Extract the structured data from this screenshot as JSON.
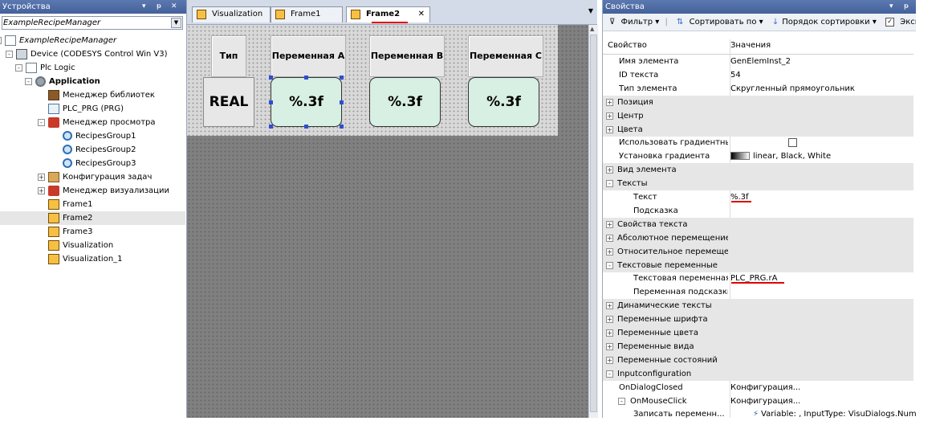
{
  "devices_pane": {
    "title": "Устройства",
    "project_combo": "ExampleRecipeManager",
    "tree": [
      {
        "label": "ExampleRecipeManager",
        "icon": "project-icon",
        "expand": "-"
      },
      {
        "label": "Device (CODESYS Control Win V3)",
        "icon": "device-icon",
        "expand": "-"
      },
      {
        "label": "Plc Logic",
        "icon": "plc-logic-icon",
        "expand": "-"
      },
      {
        "label": "Application",
        "icon": "application-icon",
        "expand": "-"
      },
      {
        "label": "Менеджер библиотек",
        "icon": "library-icon",
        "expand": ""
      },
      {
        "label": "PLC_PRG (PRG)",
        "icon": "program-icon",
        "expand": ""
      },
      {
        "label": "Менеджер просмотра",
        "icon": "watch-manager-icon",
        "expand": "-"
      },
      {
        "label": "RecipesGroup1",
        "icon": "recipe-group-icon",
        "expand": ""
      },
      {
        "label": "RecipesGroup2",
        "icon": "recipe-group-icon",
        "expand": ""
      },
      {
        "label": "RecipesGroup3",
        "icon": "recipe-group-icon",
        "expand": ""
      },
      {
        "label": "Конфигурация задач",
        "icon": "task-config-icon",
        "expand": "+"
      },
      {
        "label": "Менеджер визуализации",
        "icon": "visu-manager-icon",
        "expand": "+"
      },
      {
        "label": "Frame1",
        "icon": "frame-icon",
        "expand": ""
      },
      {
        "label": "Frame2",
        "icon": "frame-icon",
        "expand": ""
      },
      {
        "label": "Frame3",
        "icon": "frame-icon",
        "expand": ""
      },
      {
        "label": "Visualization",
        "icon": "frame-icon",
        "expand": ""
      },
      {
        "label": "Visualization_1",
        "icon": "frame-icon",
        "expand": ""
      }
    ]
  },
  "tabs": [
    {
      "label": "Visualization",
      "active": false
    },
    {
      "label": "Frame1",
      "active": false
    },
    {
      "label": "Frame2",
      "active": true
    }
  ],
  "tab_close": "✕",
  "visu": {
    "headers": [
      "Тип",
      "Переменная A",
      "Переменная B",
      "Переменная C"
    ],
    "values": [
      "REAL",
      "%.3f",
      "%.3f",
      "%.3f"
    ]
  },
  "properties": {
    "title": "Свойства",
    "toolbar": {
      "filter": "Фильтр",
      "sort_by": "Сортировать по",
      "sort_order": "Порядок сортировки",
      "expert": "Эксперт"
    },
    "col_property": "Свойство",
    "col_value": "Значения",
    "rows": [
      {
        "name": "Имя элемента",
        "value": "GenElemInst_2",
        "level": 1,
        "type": "leaf"
      },
      {
        "name": "ID текста",
        "value": "54",
        "level": 1,
        "type": "leaf"
      },
      {
        "name": "Тип элемента",
        "value": "Скругленный прямоугольник",
        "level": 1,
        "type": "leaf"
      },
      {
        "name": "Позиция",
        "value": "",
        "level": 0,
        "type": "cat",
        "expand": "+"
      },
      {
        "name": "Центр",
        "value": "",
        "level": 0,
        "type": "cat",
        "expand": "+"
      },
      {
        "name": "Цвета",
        "value": "",
        "level": 0,
        "type": "cat",
        "expand": "+"
      },
      {
        "name": "Использовать градиентный...",
        "value": "",
        "level": 1,
        "type": "leaf",
        "checkbox": true
      },
      {
        "name": "Установка градиента",
        "value": "linear, Black, White",
        "level": 1,
        "type": "leaf",
        "swatch": true
      },
      {
        "name": "Вид элемента",
        "value": "",
        "level": 0,
        "type": "cat",
        "expand": "+"
      },
      {
        "name": "Тексты",
        "value": "",
        "level": 0,
        "type": "cat",
        "expand": "-"
      },
      {
        "name": "Текст",
        "value": "%.3f",
        "level": 2,
        "type": "leaf"
      },
      {
        "name": "Подсказка",
        "value": "",
        "level": 2,
        "type": "leaf"
      },
      {
        "name": "Свойства текста",
        "value": "",
        "level": 0,
        "type": "cat",
        "expand": "+"
      },
      {
        "name": "Абсолютное перемещение",
        "value": "",
        "level": 0,
        "type": "cat",
        "expand": "+"
      },
      {
        "name": "Относительное перемещение",
        "value": "",
        "level": 0,
        "type": "cat",
        "expand": "+"
      },
      {
        "name": "Текстовые переменные",
        "value": "",
        "level": 0,
        "type": "cat",
        "expand": "-"
      },
      {
        "name": "Текстовая переменная",
        "value": "PLC_PRG.rA",
        "level": 2,
        "type": "leaf"
      },
      {
        "name": "Переменная подсказки",
        "value": "",
        "level": 2,
        "type": "leaf"
      },
      {
        "name": "Динамические тексты",
        "value": "",
        "level": 0,
        "type": "cat",
        "expand": "+"
      },
      {
        "name": "Переменные шрифта",
        "value": "",
        "level": 0,
        "type": "cat",
        "expand": "+"
      },
      {
        "name": "Переменные цвета",
        "value": "",
        "level": 0,
        "type": "cat",
        "expand": "+"
      },
      {
        "name": "Переменные вида",
        "value": "",
        "level": 0,
        "type": "cat",
        "expand": "+"
      },
      {
        "name": "Переменные состояний",
        "value": "",
        "level": 0,
        "type": "cat",
        "expand": "+"
      },
      {
        "name": "Inputconfiguration",
        "value": "",
        "level": 0,
        "type": "cat",
        "expand": "-"
      },
      {
        "name": "OnDialogClosed",
        "value": "Конфигурация...",
        "level": 1,
        "type": "leaf"
      },
      {
        "name": "OnMouseClick",
        "value": "Конфигурация...",
        "level": 1,
        "type": "leaf",
        "expand": "-"
      },
      {
        "name": "Записать переменн...",
        "value": "Variable: , InputType: VisuDialogs.Nump...",
        "level": 2,
        "type": "leaf",
        "icon": true
      }
    ]
  }
}
